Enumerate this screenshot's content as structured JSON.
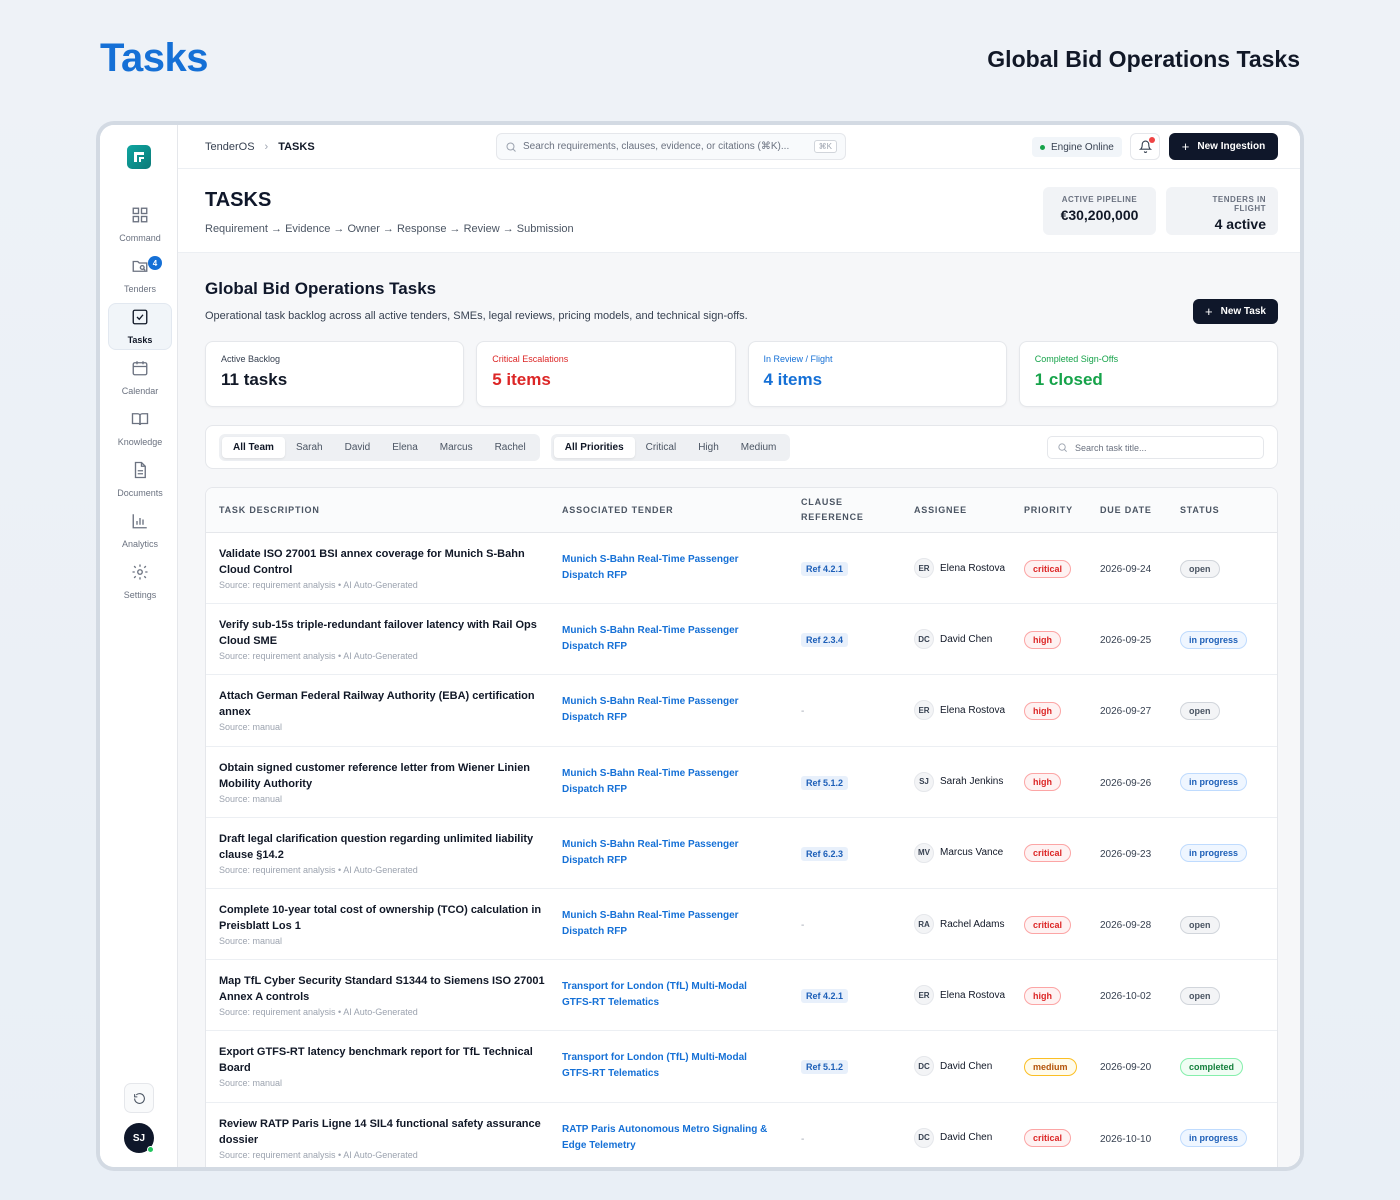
{
  "page": {
    "title": "Tasks",
    "subtitle": "Global Bid Operations Tasks"
  },
  "sidebar": {
    "items": [
      {
        "label": "Command",
        "icon": "grid-icon"
      },
      {
        "label": "Tenders",
        "icon": "folder-search-icon",
        "badge": "4"
      },
      {
        "label": "Tasks",
        "icon": "checkbox-icon",
        "active": true
      },
      {
        "label": "Calendar",
        "icon": "calendar-icon"
      },
      {
        "label": "Knowledge",
        "icon": "book-icon"
      },
      {
        "label": "Documents",
        "icon": "document-icon"
      },
      {
        "label": "Analytics",
        "icon": "bar-chart-icon"
      },
      {
        "label": "Settings",
        "icon": "gear-icon"
      }
    ],
    "avatar": "SJ"
  },
  "topbar": {
    "breadcrumb_root": "TenderOS",
    "breadcrumb_current": "TASKS",
    "search_placeholder": "Search requirements, clauses, evidence, or citations (⌘K)...",
    "search_kbd": "⌘K",
    "engine_status": "Engine Online",
    "new_ingestion": "New Ingestion"
  },
  "header": {
    "title": "TASKS",
    "flow": "Requirement → Evidence → Owner → Response → Review → Submission",
    "kpis": [
      {
        "label": "ACTIVE PIPELINE",
        "value": "€30,200,000"
      },
      {
        "label": "TENDERS IN FLIGHT",
        "value": "4 active"
      }
    ]
  },
  "section": {
    "title": "Global Bid Operations Tasks",
    "subtitle": "Operational task backlog across all active tenders, SMEs, legal reviews, pricing models, and technical sign-offs.",
    "new_task": "New Task"
  },
  "stats": [
    {
      "label": "Active Backlog",
      "value": "11 tasks",
      "color": "#111827"
    },
    {
      "label": "Critical Escalations",
      "value": "5 items",
      "color": "#dc2626"
    },
    {
      "label": "In Review / Flight",
      "value": "4 items",
      "color": "#1570d6"
    },
    {
      "label": "Completed Sign-Offs",
      "value": "1 closed",
      "color": "#16a34a"
    }
  ],
  "filters": {
    "team": [
      "All Team",
      "Sarah",
      "David",
      "Elena",
      "Marcus",
      "Rachel"
    ],
    "priority": [
      "All Priorities",
      "Critical",
      "High",
      "Medium"
    ],
    "search_placeholder": "Search task title..."
  },
  "table": {
    "columns": [
      "TASK DESCRIPTION",
      "ASSOCIATED TENDER",
      "CLAUSE REFERENCE",
      "ASSIGNEE",
      "PRIORITY",
      "DUE DATE",
      "STATUS"
    ],
    "rows": [
      {
        "title": "Validate ISO 27001 BSI annex coverage for Munich S-Bahn Cloud Control",
        "source": "Source: requirement analysis • AI Auto-Generated",
        "tender": "Munich S-Bahn Real-Time Passenger Dispatch RFP",
        "ref": "Ref 4.2.1",
        "initials": "ER",
        "assignee": "Elena Rostova",
        "priority": "critical",
        "due": "2026-09-24",
        "status": "open"
      },
      {
        "title": "Verify sub-15s triple-redundant failover latency with Rail Ops Cloud SME",
        "source": "Source: requirement analysis • AI Auto-Generated",
        "tender": "Munich S-Bahn Real-Time Passenger Dispatch RFP",
        "ref": "Ref 2.3.4",
        "initials": "DC",
        "assignee": "David Chen",
        "priority": "high",
        "due": "2026-09-25",
        "status": "in progress"
      },
      {
        "title": "Attach German Federal Railway Authority (EBA) certification annex",
        "source": "Source: manual",
        "tender": "Munich S-Bahn Real-Time Passenger Dispatch RFP",
        "ref": "-",
        "initials": "ER",
        "assignee": "Elena Rostova",
        "priority": "high",
        "due": "2026-09-27",
        "status": "open"
      },
      {
        "title": "Obtain signed customer reference letter from Wiener Linien Mobility Authority",
        "source": "Source: manual",
        "tender": "Munich S-Bahn Real-Time Passenger Dispatch RFP",
        "ref": "Ref 5.1.2",
        "initials": "SJ",
        "assignee": "Sarah Jenkins",
        "priority": "high",
        "due": "2026-09-26",
        "status": "in progress"
      },
      {
        "title": "Draft legal clarification question regarding unlimited liability clause §14.2",
        "source": "Source: requirement analysis • AI Auto-Generated",
        "tender": "Munich S-Bahn Real-Time Passenger Dispatch RFP",
        "ref": "Ref 6.2.3",
        "initials": "MV",
        "assignee": "Marcus Vance",
        "priority": "critical",
        "due": "2026-09-23",
        "status": "in progress"
      },
      {
        "title": "Complete 10-year total cost of ownership (TCO) calculation in Preisblatt Los 1",
        "source": "Source: manual",
        "tender": "Munich S-Bahn Real-Time Passenger Dispatch RFP",
        "ref": "-",
        "initials": "RA",
        "assignee": "Rachel Adams",
        "priority": "critical",
        "due": "2026-09-28",
        "status": "open"
      },
      {
        "title": "Map TfL Cyber Security Standard S1344 to Siemens ISO 27001 Annex A controls",
        "source": "Source: requirement analysis • AI Auto-Generated",
        "tender": "Transport for London (TfL) Multi-Modal GTFS-RT Telematics",
        "ref": "Ref 4.2.1",
        "initials": "ER",
        "assignee": "Elena Rostova",
        "priority": "high",
        "due": "2026-10-02",
        "status": "open"
      },
      {
        "title": "Export GTFS-RT latency benchmark report for TfL Technical Board",
        "source": "Source: manual",
        "tender": "Transport for London (TfL) Multi-Modal GTFS-RT Telematics",
        "ref": "Ref 5.1.2",
        "initials": "DC",
        "assignee": "David Chen",
        "priority": "medium",
        "due": "2026-09-20",
        "status": "completed"
      },
      {
        "title": "Review RATP Paris Ligne 14 SIL4 functional safety assurance dossier",
        "source": "Source: requirement analysis • AI Auto-Generated",
        "tender": "RATP Paris Autonomous Metro Signaling & Edge Telemetry",
        "ref": "-",
        "initials": "DC",
        "assignee": "David Chen",
        "priority": "critical",
        "due": "2026-10-10",
        "status": "in progress"
      }
    ]
  }
}
